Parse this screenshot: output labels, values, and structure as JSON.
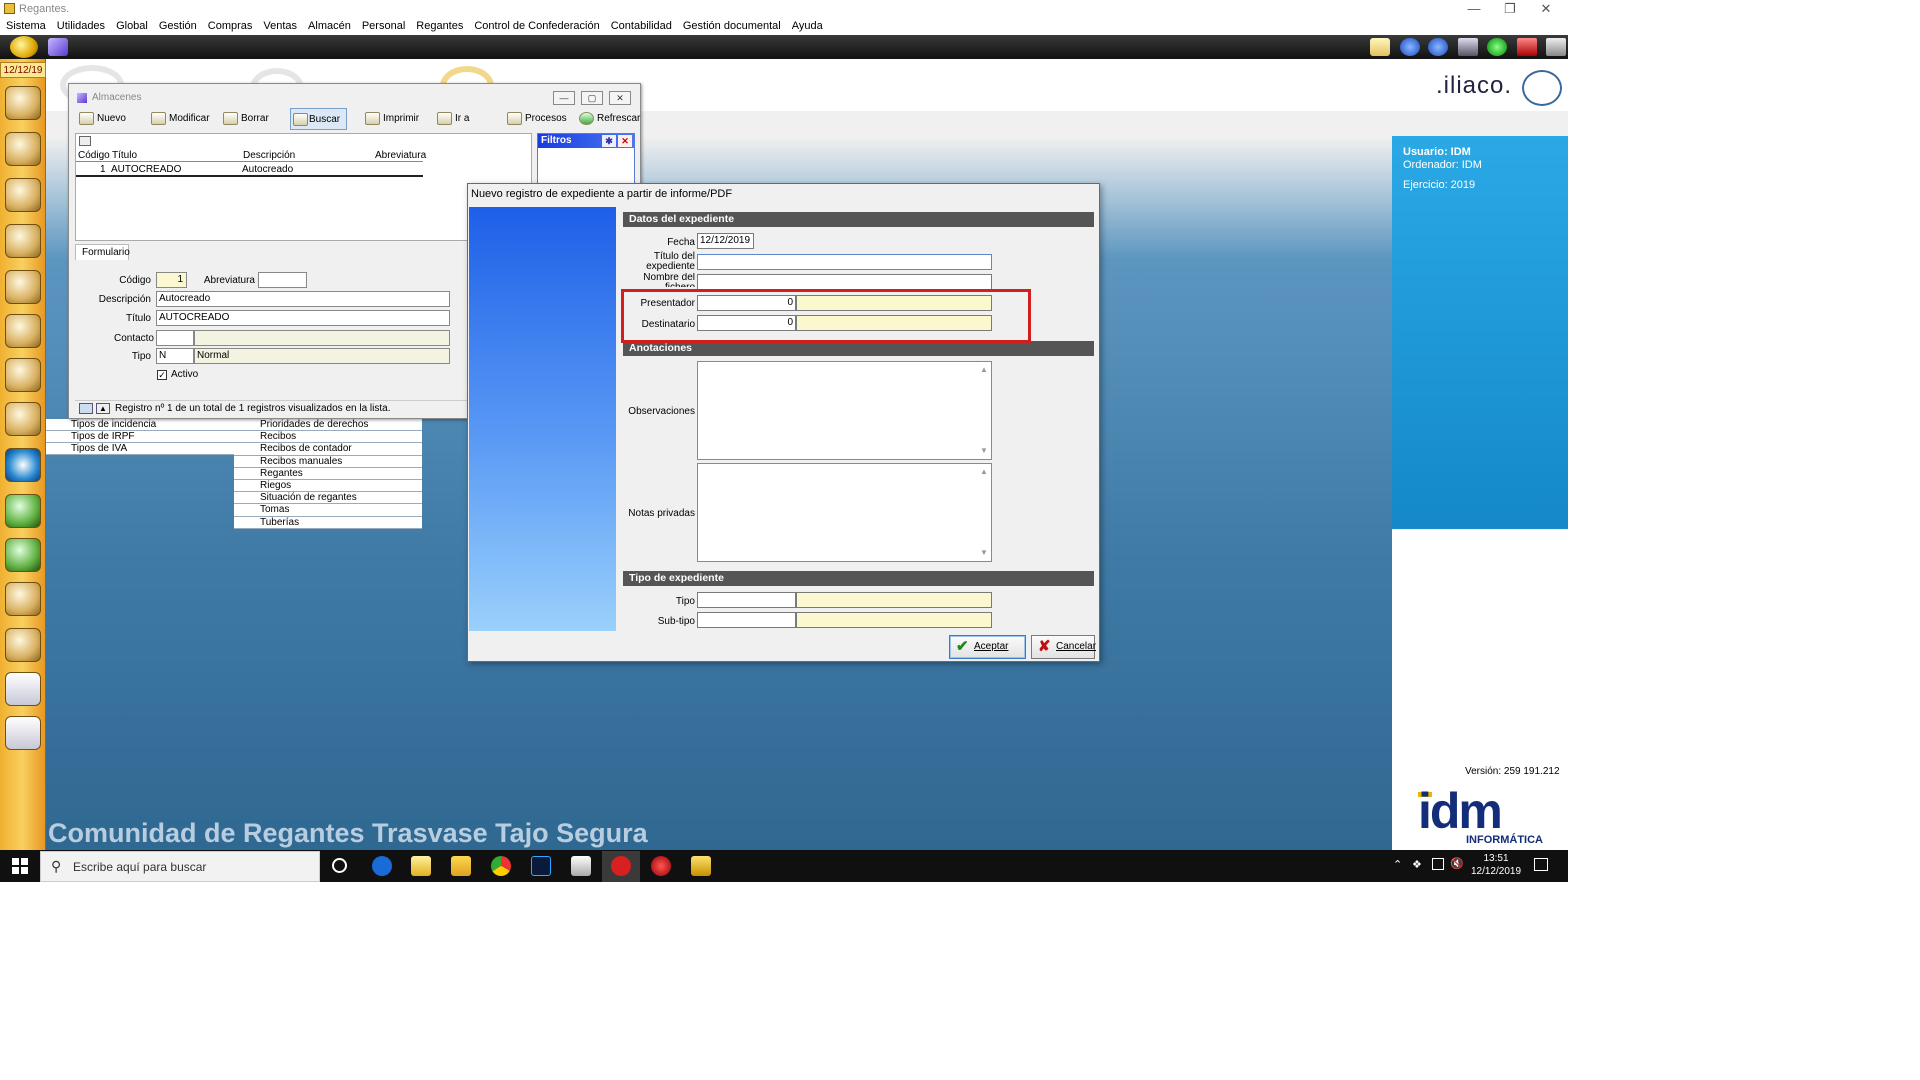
{
  "window": {
    "title": "Regantes."
  },
  "menu": [
    "Sistema",
    "Utilidades",
    "Global",
    "Gestión",
    "Compras",
    "Ventas",
    "Almacén",
    "Personal",
    "Regantes",
    "Control de Confederación",
    "Contabilidad",
    "Gestión documental",
    "Ayuda"
  ],
  "dock": {
    "date": "12/12/19"
  },
  "branding": {
    "iliaco": ".iliaco.",
    "community": "Comunidad de Regantes Trasvase Tajo Segura",
    "version": "Versión: 259 191.212",
    "idm": "idm",
    "idm_sub": "INFORMÁTICA"
  },
  "user_panel": {
    "usuario": "Usuario: IDM",
    "ordenador": "Ordenador: IDM",
    "ejercicio": "Ejercicio: 2019"
  },
  "bg_list_left": [
    "Tipos de incidencia",
    "Tipos de IRPF",
    "Tipos de IVA"
  ],
  "bg_list_right": [
    "Prioridades de derechos",
    "Recibos",
    "Recibos de contador",
    "Recibos manuales",
    "Regantes",
    "Riegos",
    "Situación de regantes",
    "Tomas",
    "Tuberías"
  ],
  "almacenes": {
    "title": "Almacenes",
    "toolbar": {
      "nuevo": "Nuevo",
      "modificar": "Modificar",
      "borrar": "Borrar",
      "buscar": "Buscar",
      "imprimir": "Imprimir",
      "ir_a": "Ir a",
      "procesos": "Procesos",
      "refrescar": "Refrescar"
    },
    "filtros": "Filtros",
    "grid": {
      "headers": {
        "codigo": "Código",
        "titulo": "Título",
        "descripcion": "Descripción",
        "abreviatura": "Abreviatura"
      },
      "row": {
        "codigo": "1",
        "titulo": "AUTOCREADO",
        "descripcion": "Autocreado",
        "abreviatura": ""
      }
    },
    "tab": "Formulario",
    "form": {
      "codigo_label": "Código",
      "codigo": "1",
      "abreviatura_label": "Abreviatura",
      "abreviatura": "",
      "descripcion_label": "Descripción",
      "descripcion": "Autocreado",
      "titulo_label": "Título",
      "titulo": "AUTOCREADO",
      "contacto_label": "Contacto",
      "contacto": "",
      "tipo_label": "Tipo",
      "tipo_code": "N",
      "tipo_name": "Normal",
      "activo_label": "Activo"
    },
    "status": "Registro nº 1 de un total de 1 registros visualizados en la lista."
  },
  "dialog": {
    "title": "Nuevo registro de expediente a partir de informe/PDF",
    "sections": {
      "datos": "Datos del expediente",
      "anotaciones": "Anotaciones",
      "tipo": "Tipo de expediente"
    },
    "fields": {
      "fecha_label": "Fecha",
      "fecha": "12/12/2019",
      "titulo_label": "Título del expediente",
      "titulo": "",
      "fichero_label": "Nombre del fichero",
      "fichero": "",
      "presentador_label": "Presentador",
      "presentador": "0",
      "presentador_name": "",
      "destinatario_label": "Destinatario",
      "destinatario": "0",
      "destinatario_name": "",
      "observaciones_label": "Observaciones",
      "notas_label": "Notas privadas",
      "tipo_label": "Tipo",
      "subtipo_label": "Sub-tipo"
    },
    "buttons": {
      "aceptar": "Aceptar",
      "cancelar": "Cancelar"
    }
  },
  "taskbar": {
    "search_placeholder": "Escribe aquí para buscar",
    "time": "13:51",
    "date": "12/12/2019"
  }
}
